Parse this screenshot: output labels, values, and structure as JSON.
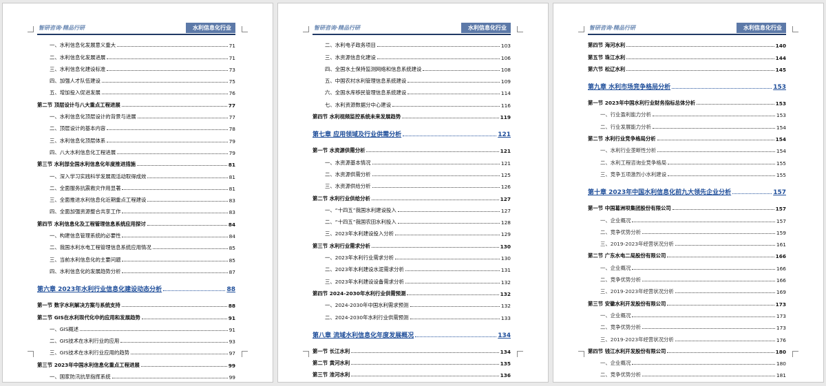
{
  "pages": [
    {
      "header_left": "智研咨询·精品行研",
      "header_right": "水利信息化行业",
      "lines": [
        {
          "type": "item",
          "text": "一、水利信息化发展意义重大",
          "page": "71"
        },
        {
          "type": "item",
          "text": "二、水利信息化发展进展",
          "page": "71"
        },
        {
          "type": "item",
          "text": "三、水利信息化建设标准",
          "page": "73"
        },
        {
          "type": "item",
          "text": "四、加强人才队伍建设",
          "page": "75"
        },
        {
          "type": "item",
          "text": "五、增加投入促进发展",
          "page": "76"
        },
        {
          "type": "sec",
          "text": "第二节 顶层设计与八大重点工程进展",
          "page": "77"
        },
        {
          "type": "item",
          "text": "一、水利信息化顶层设计的背景与进展",
          "page": "77"
        },
        {
          "type": "item",
          "text": "二、顶层设计的基本内容",
          "page": "78"
        },
        {
          "type": "item",
          "text": "三、水利信息化顶层体系",
          "page": "79"
        },
        {
          "type": "item",
          "text": "四、八大水利信息化工程进展",
          "page": "79"
        },
        {
          "type": "sec",
          "text": "第三节 水利部全国水利信息化年度推进措施",
          "page": "81"
        },
        {
          "type": "item",
          "text": "一、深入学习实践科学发展观活动取得成效",
          "page": "81"
        },
        {
          "type": "item",
          "text": "二、全面服务抗震救灾作用显著",
          "page": "81"
        },
        {
          "type": "item",
          "text": "三、全面推进水利信息化近期重点工程建设",
          "page": "83"
        },
        {
          "type": "item",
          "text": "四、全面加强资源整合共享工作",
          "page": "83"
        },
        {
          "type": "sec",
          "text": "第四节 水利信息化及工程管理信息系统应用探讨",
          "page": "84"
        },
        {
          "type": "item",
          "text": "一、构建信息管理系统的必要性",
          "page": "84"
        },
        {
          "type": "item",
          "text": "二、我国水利水电工程管理信息系统应用情况",
          "page": "85"
        },
        {
          "type": "item",
          "text": "三、当前水利信息化的主要问题",
          "page": "85"
        },
        {
          "type": "item",
          "text": "四、水利信息化的发展趋势分析",
          "page": "87"
        },
        {
          "type": "chap",
          "text": "第六章 2023年水利行业信息化建设动态分析",
          "page": "88"
        },
        {
          "type": "sec",
          "text": "第一节 数字水利解决方案与系统支持",
          "page": "88"
        },
        {
          "type": "sec",
          "text": "第二节 GIS在水利现代化中的应用和发展趋势",
          "page": "91"
        },
        {
          "type": "item",
          "text": "一、GIS概述",
          "page": "91"
        },
        {
          "type": "item",
          "text": "二、GIS技术在水利行业的应用",
          "page": "93"
        },
        {
          "type": "item",
          "text": "三、GIS技术在水利行业应用的趋势",
          "page": "97"
        },
        {
          "type": "sec",
          "text": "第三节 2023年中国水利信息化重点工程进展",
          "page": "99"
        },
        {
          "type": "item",
          "text": "一、国家防汛抗旱指挥系统",
          "page": "99"
        }
      ]
    },
    {
      "header_left": "智研咨询·精品行研",
      "header_right": "水利信息化行业",
      "lines": [
        {
          "type": "item",
          "text": "二、水利电子政务项目",
          "page": "103"
        },
        {
          "type": "item",
          "text": "三、水资源信息化建设",
          "page": "106"
        },
        {
          "type": "item",
          "text": "四、全国水土保持监测网络和信息系统建设",
          "page": "108"
        },
        {
          "type": "item",
          "text": "五、中国农村水利管理信息系统建设",
          "page": "109"
        },
        {
          "type": "item",
          "text": "六、全国水库移民管理信息系统建设",
          "page": "114"
        },
        {
          "type": "item",
          "text": "七、水利资源数据分中心建设",
          "page": "116"
        },
        {
          "type": "sec",
          "text": "第四节 水利视频监控系统未来发展趋势",
          "page": "119"
        },
        {
          "type": "chap",
          "text": "第七章 应用领域及行业供需分析",
          "page": "121"
        },
        {
          "type": "sec",
          "text": "第一节 水资源供需分析",
          "page": "121"
        },
        {
          "type": "item",
          "text": "一、水资源基本情况",
          "page": "121"
        },
        {
          "type": "item",
          "text": "二、水资源供需分析",
          "page": "125"
        },
        {
          "type": "item",
          "text": "三、水资源供给分析",
          "page": "126"
        },
        {
          "type": "sec",
          "text": "第二节 水利行业供给分析",
          "page": "127"
        },
        {
          "type": "item",
          "text": "一、“十四五”我国水利建设投入",
          "page": "127"
        },
        {
          "type": "item",
          "text": "二、“十四五”我国农田水利投入",
          "page": "128"
        },
        {
          "type": "item",
          "text": "三、2023年水利建设投入分析",
          "page": "129"
        },
        {
          "type": "sec",
          "text": "第三节 水利行业需求分析",
          "page": "130"
        },
        {
          "type": "item",
          "text": "一、2023年水利行业需求分析",
          "page": "130"
        },
        {
          "type": "item",
          "text": "二、2023年水利建设水泥需求分析",
          "page": "131"
        },
        {
          "type": "item",
          "text": "三、2023年水利建设设备需求分析",
          "page": "132"
        },
        {
          "type": "sec",
          "text": "第四节 2024-2030年水利行业供需预测",
          "page": "132"
        },
        {
          "type": "item",
          "text": "一、2024-2030年中国水利需求预测",
          "page": "132"
        },
        {
          "type": "item",
          "text": "二、2024-2030年水利行业供需预测",
          "page": "133"
        },
        {
          "type": "chap",
          "text": "第八章 流域水利信息化年度发展概况",
          "page": "134"
        },
        {
          "type": "sec",
          "text": "第一节 长江水利",
          "page": "134"
        },
        {
          "type": "sec",
          "text": "第二节 黄河水利",
          "page": "135"
        },
        {
          "type": "sec",
          "text": "第三节 淮河水利",
          "page": "136"
        }
      ]
    },
    {
      "header_left": "智研咨询·精品行研",
      "header_right": "水利信息化行业",
      "lines": [
        {
          "type": "sec",
          "text": "第四节 海河水利",
          "page": "140"
        },
        {
          "type": "sec",
          "text": "第五节 珠江水利",
          "page": "144"
        },
        {
          "type": "sec",
          "text": "第六节 松辽水利",
          "page": "145"
        },
        {
          "type": "chap",
          "text": "第九章 水利市场竞争格局分析",
          "page": "153"
        },
        {
          "type": "sec",
          "text": "第一节 2023年中国水利行业财务指标总体分析",
          "page": "153"
        },
        {
          "type": "sub",
          "text": "一、行业盈利能力分析",
          "page": "153"
        },
        {
          "type": "sub",
          "text": "二、行业发展能力分析",
          "page": "154"
        },
        {
          "type": "sec",
          "text": "第二节 水利行业竞争格局分析",
          "page": "154"
        },
        {
          "type": "sub",
          "text": "一、水利行业垄断性分析",
          "page": "154"
        },
        {
          "type": "sub",
          "text": "二、水利工程咨询业竞争格局",
          "page": "155"
        },
        {
          "type": "sub",
          "text": "三、竞争五项激烈小水利建设",
          "page": "155"
        },
        {
          "type": "chap",
          "text": "第十章 2023年中国水利信息化前九大领先企业分析",
          "page": "157"
        },
        {
          "type": "sec",
          "text": "第一节 中国葛洲坝集团股份有限公司",
          "page": "157"
        },
        {
          "type": "sub",
          "text": "一、企业概况",
          "page": "157"
        },
        {
          "type": "sub",
          "text": "二、竞争优势分析",
          "page": "159"
        },
        {
          "type": "sub",
          "text": "三、2019-2023年经营状况分析",
          "page": "161"
        },
        {
          "type": "sec",
          "text": "第二节 广东水电二局股份有限公司",
          "page": "166"
        },
        {
          "type": "sub",
          "text": "一、企业概况",
          "page": "166"
        },
        {
          "type": "sub",
          "text": "二、竞争优势分析",
          "page": "166"
        },
        {
          "type": "sub",
          "text": "三、2019-2023年经营状况分析",
          "page": "169"
        },
        {
          "type": "sec",
          "text": "第三节 安徽水利开发股份有限公司",
          "page": "173"
        },
        {
          "type": "sub",
          "text": "一、企业概况",
          "page": "173"
        },
        {
          "type": "sub",
          "text": "二、竞争优势分析",
          "page": "173"
        },
        {
          "type": "sub",
          "text": "三、2019-2023年经营状况分析",
          "page": "176"
        },
        {
          "type": "sec",
          "text": "第四节 钱江水利开发股份有限公司",
          "page": "180"
        },
        {
          "type": "sub",
          "text": "一、企业概况",
          "page": "180"
        },
        {
          "type": "sub",
          "text": "二、竞争优势分析",
          "page": "181"
        }
      ]
    }
  ]
}
